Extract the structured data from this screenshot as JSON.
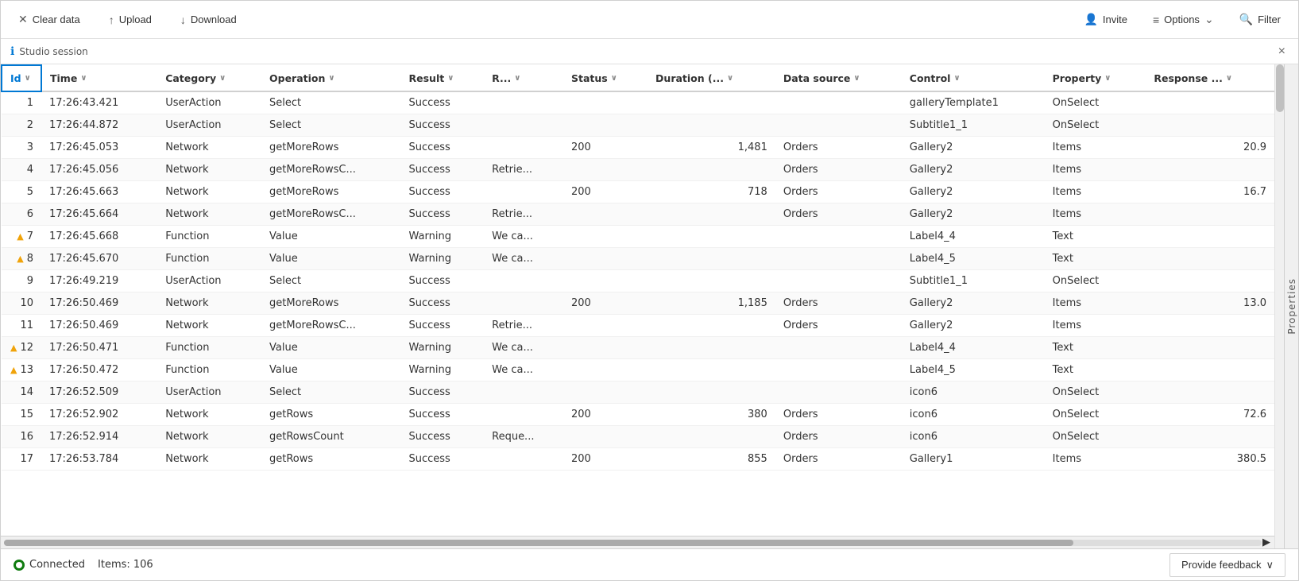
{
  "toolbar": {
    "clear_data_label": "Clear data",
    "upload_label": "Upload",
    "download_label": "Download",
    "invite_label": "Invite",
    "options_label": "Options",
    "filter_label": "Filter"
  },
  "session": {
    "label": "Studio session",
    "close_label": "×"
  },
  "table": {
    "columns": [
      {
        "id": "col-id",
        "label": "Id",
        "sort": true
      },
      {
        "id": "col-time",
        "label": "Time",
        "sort": true
      },
      {
        "id": "col-category",
        "label": "Category",
        "sort": true
      },
      {
        "id": "col-operation",
        "label": "Operation",
        "sort": true
      },
      {
        "id": "col-result",
        "label": "Result",
        "sort": true
      },
      {
        "id": "col-r",
        "label": "R...",
        "sort": true
      },
      {
        "id": "col-status",
        "label": "Status",
        "sort": true
      },
      {
        "id": "col-duration",
        "label": "Duration (..",
        "sort": true
      },
      {
        "id": "col-datasource",
        "label": "Data source",
        "sort": true
      },
      {
        "id": "col-control",
        "label": "Control",
        "sort": true
      },
      {
        "id": "col-property",
        "label": "Property",
        "sort": true
      },
      {
        "id": "col-response",
        "label": "Response ...",
        "sort": true
      }
    ],
    "rows": [
      {
        "id": 1,
        "time": "17:26:43.421",
        "category": "UserAction",
        "operation": "Select",
        "result": "Success",
        "r": "",
        "status": "",
        "duration": "",
        "datasource": "",
        "control": "galleryTemplate1",
        "property": "OnSelect",
        "response": ""
      },
      {
        "id": 2,
        "time": "17:26:44.872",
        "category": "UserAction",
        "operation": "Select",
        "result": "Success",
        "r": "",
        "status": "",
        "duration": "",
        "datasource": "",
        "control": "Subtitle1_1",
        "property": "OnSelect",
        "response": ""
      },
      {
        "id": 3,
        "time": "17:26:45.053",
        "category": "Network",
        "operation": "getMoreRows",
        "result": "Success",
        "r": "",
        "status": "200",
        "duration": "1,481",
        "datasource": "Orders",
        "control": "Gallery2",
        "property": "Items",
        "response": "20.9"
      },
      {
        "id": 4,
        "time": "17:26:45.056",
        "category": "Network",
        "operation": "getMoreRowsC...",
        "result": "Success",
        "r": "Retrie...",
        "status": "",
        "duration": "",
        "datasource": "Orders",
        "control": "Gallery2",
        "property": "Items",
        "response": ""
      },
      {
        "id": 5,
        "time": "17:26:45.663",
        "category": "Network",
        "operation": "getMoreRows",
        "result": "Success",
        "r": "",
        "status": "200",
        "duration": "718",
        "datasource": "Orders",
        "control": "Gallery2",
        "property": "Items",
        "response": "16.7"
      },
      {
        "id": 6,
        "time": "17:26:45.664",
        "category": "Network",
        "operation": "getMoreRowsC...",
        "result": "Success",
        "r": "Retrie...",
        "status": "",
        "duration": "",
        "datasource": "Orders",
        "control": "Gallery2",
        "property": "Items",
        "response": ""
      },
      {
        "id": 7,
        "time": "17:26:45.668",
        "category": "Function",
        "operation": "Value",
        "result": "Warning",
        "r": "We ca...",
        "status": "",
        "duration": "",
        "datasource": "",
        "control": "Label4_4",
        "property": "Text",
        "response": "",
        "warning": true
      },
      {
        "id": 8,
        "time": "17:26:45.670",
        "category": "Function",
        "operation": "Value",
        "result": "Warning",
        "r": "We ca...",
        "status": "",
        "duration": "",
        "datasource": "",
        "control": "Label4_5",
        "property": "Text",
        "response": "",
        "warning": true
      },
      {
        "id": 9,
        "time": "17:26:49.219",
        "category": "UserAction",
        "operation": "Select",
        "result": "Success",
        "r": "",
        "status": "",
        "duration": "",
        "datasource": "",
        "control": "Subtitle1_1",
        "property": "OnSelect",
        "response": ""
      },
      {
        "id": 10,
        "time": "17:26:50.469",
        "category": "Network",
        "operation": "getMoreRows",
        "result": "Success",
        "r": "",
        "status": "200",
        "duration": "1,185",
        "datasource": "Orders",
        "control": "Gallery2",
        "property": "Items",
        "response": "13.0"
      },
      {
        "id": 11,
        "time": "17:26:50.469",
        "category": "Network",
        "operation": "getMoreRowsC...",
        "result": "Success",
        "r": "Retrie...",
        "status": "",
        "duration": "",
        "datasource": "Orders",
        "control": "Gallery2",
        "property": "Items",
        "response": ""
      },
      {
        "id": 12,
        "time": "17:26:50.471",
        "category": "Function",
        "operation": "Value",
        "result": "Warning",
        "r": "We ca...",
        "status": "",
        "duration": "",
        "datasource": "",
        "control": "Label4_4",
        "property": "Text",
        "response": "",
        "warning": true
      },
      {
        "id": 13,
        "time": "17:26:50.472",
        "category": "Function",
        "operation": "Value",
        "result": "Warning",
        "r": "We ca...",
        "status": "",
        "duration": "",
        "datasource": "",
        "control": "Label4_5",
        "property": "Text",
        "response": "",
        "warning": true
      },
      {
        "id": 14,
        "time": "17:26:52.509",
        "category": "UserAction",
        "operation": "Select",
        "result": "Success",
        "r": "",
        "status": "",
        "duration": "",
        "datasource": "",
        "control": "icon6",
        "property": "OnSelect",
        "response": ""
      },
      {
        "id": 15,
        "time": "17:26:52.902",
        "category": "Network",
        "operation": "getRows",
        "result": "Success",
        "r": "",
        "status": "200",
        "duration": "380",
        "datasource": "Orders",
        "control": "icon6",
        "property": "OnSelect",
        "response": "72.6"
      },
      {
        "id": 16,
        "time": "17:26:52.914",
        "category": "Network",
        "operation": "getRowsCount",
        "result": "Success",
        "r": "Reque...",
        "status": "",
        "duration": "",
        "datasource": "Orders",
        "control": "icon6",
        "property": "OnSelect",
        "response": ""
      },
      {
        "id": 17,
        "time": "17:26:53.784",
        "category": "Network",
        "operation": "getRows",
        "result": "Success",
        "r": "",
        "status": "200",
        "duration": "855",
        "datasource": "Orders",
        "control": "Gallery1",
        "property": "Items",
        "response": "380.5"
      }
    ]
  },
  "right_panel": {
    "label": "Properties"
  },
  "status_bar": {
    "connected_label": "Connected",
    "items_label": "Items: 106",
    "provide_feedback_label": "Provide feedback"
  }
}
